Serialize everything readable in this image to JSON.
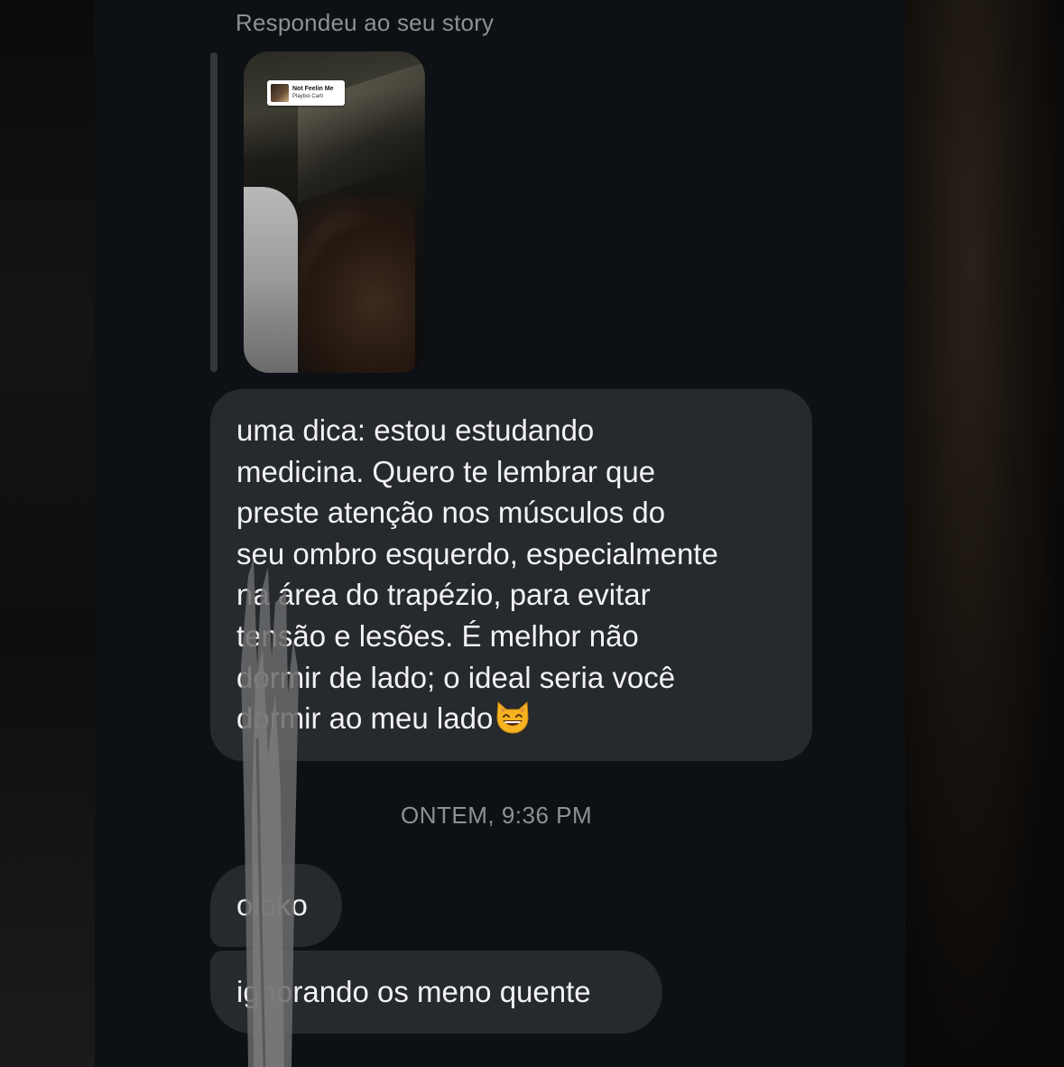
{
  "reply_caption": "Respondeu ao seu story",
  "story": {
    "music_title": "Not Feelin Me",
    "music_artist": "Playboi Carti"
  },
  "messages": {
    "received_1": {
      "lines": [
        "uma dica: estou estudando",
        "medicina. Quero te lembrar que",
        "preste atenção nos músculos do",
        "seu ombro esquerdo, especialmente",
        "na área do trapézio, para evitar",
        "tensão e lesões. É melhor não",
        "dormir de lado; o ideal seria você",
        "dormir ao meu lado"
      ],
      "emoji": "grinning-cat-emoji"
    },
    "timestamp": "ONTEM, 9:36 PM",
    "received_2": "oloko",
    "received_3": "ignorando os meno quente"
  },
  "colors": {
    "background": "#0d1014",
    "bubble": "#26292e",
    "text": "#f2f2f4",
    "muted": "#8e9096"
  }
}
